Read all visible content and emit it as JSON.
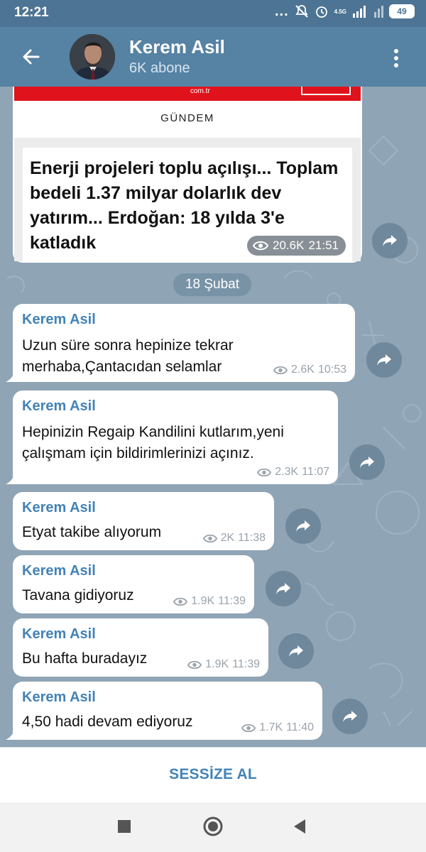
{
  "status_bar": {
    "time": "12:21",
    "dots": "...",
    "network": "4.5G",
    "battery": "49"
  },
  "header": {
    "title": "Kerem Asil",
    "subtitle": "6K abone"
  },
  "card": {
    "site": "com.tr",
    "category": "GÜNDEM",
    "headline": "Enerji projeleri toplu açılışı... Toplam bedeli 1.37 milyar dolarlık dev yatırım... Erdoğan: 18 yılda 3'e katladık",
    "views": "20.6K",
    "time": "21:51"
  },
  "date_separator": "18 Şubat",
  "messages": [
    {
      "author": "Kerem Asil",
      "line1": "Uzun süre sonra hepinize tekrar",
      "line2": "merhaba,Çantacıdan selamlar",
      "views": "2.6K",
      "time": "10:53"
    },
    {
      "author": "Kerem Asil",
      "line1": "Hepinizin Regaip Kandilini kutlarım,yeni",
      "line2": "çalışmam için bildirimlerinizi açınız.",
      "views": "2.3K",
      "time": "11:07"
    },
    {
      "author": "Kerem Asil",
      "line1": "Etyat takibe alıyorum",
      "views": "2K",
      "time": "11:38"
    },
    {
      "author": "Kerem Asil",
      "line1": "Tavana gidiyoruz",
      "views": "1.9K",
      "time": "11:39"
    },
    {
      "author": "Kerem Asil",
      "line1": "Bu hafta buradayız",
      "views": "1.9K",
      "time": "11:39"
    },
    {
      "author": "Kerem Asil",
      "line1": "4,50 hadi devam ediyoruz",
      "views": "1.7K",
      "time": "11:40"
    }
  ],
  "bottom": {
    "mute_label": "SESSİZE AL"
  },
  "colors": {
    "header": "#5682a3",
    "status_bar": "#4d7494",
    "accent": "#4283b8",
    "chat_background": "#8fa4b5"
  },
  "icons": [
    "back-arrow-icon",
    "more-vertical-icon",
    "eye-icon",
    "forward-icon",
    "nav-recents-icon",
    "nav-home-icon",
    "nav-back-icon"
  ]
}
